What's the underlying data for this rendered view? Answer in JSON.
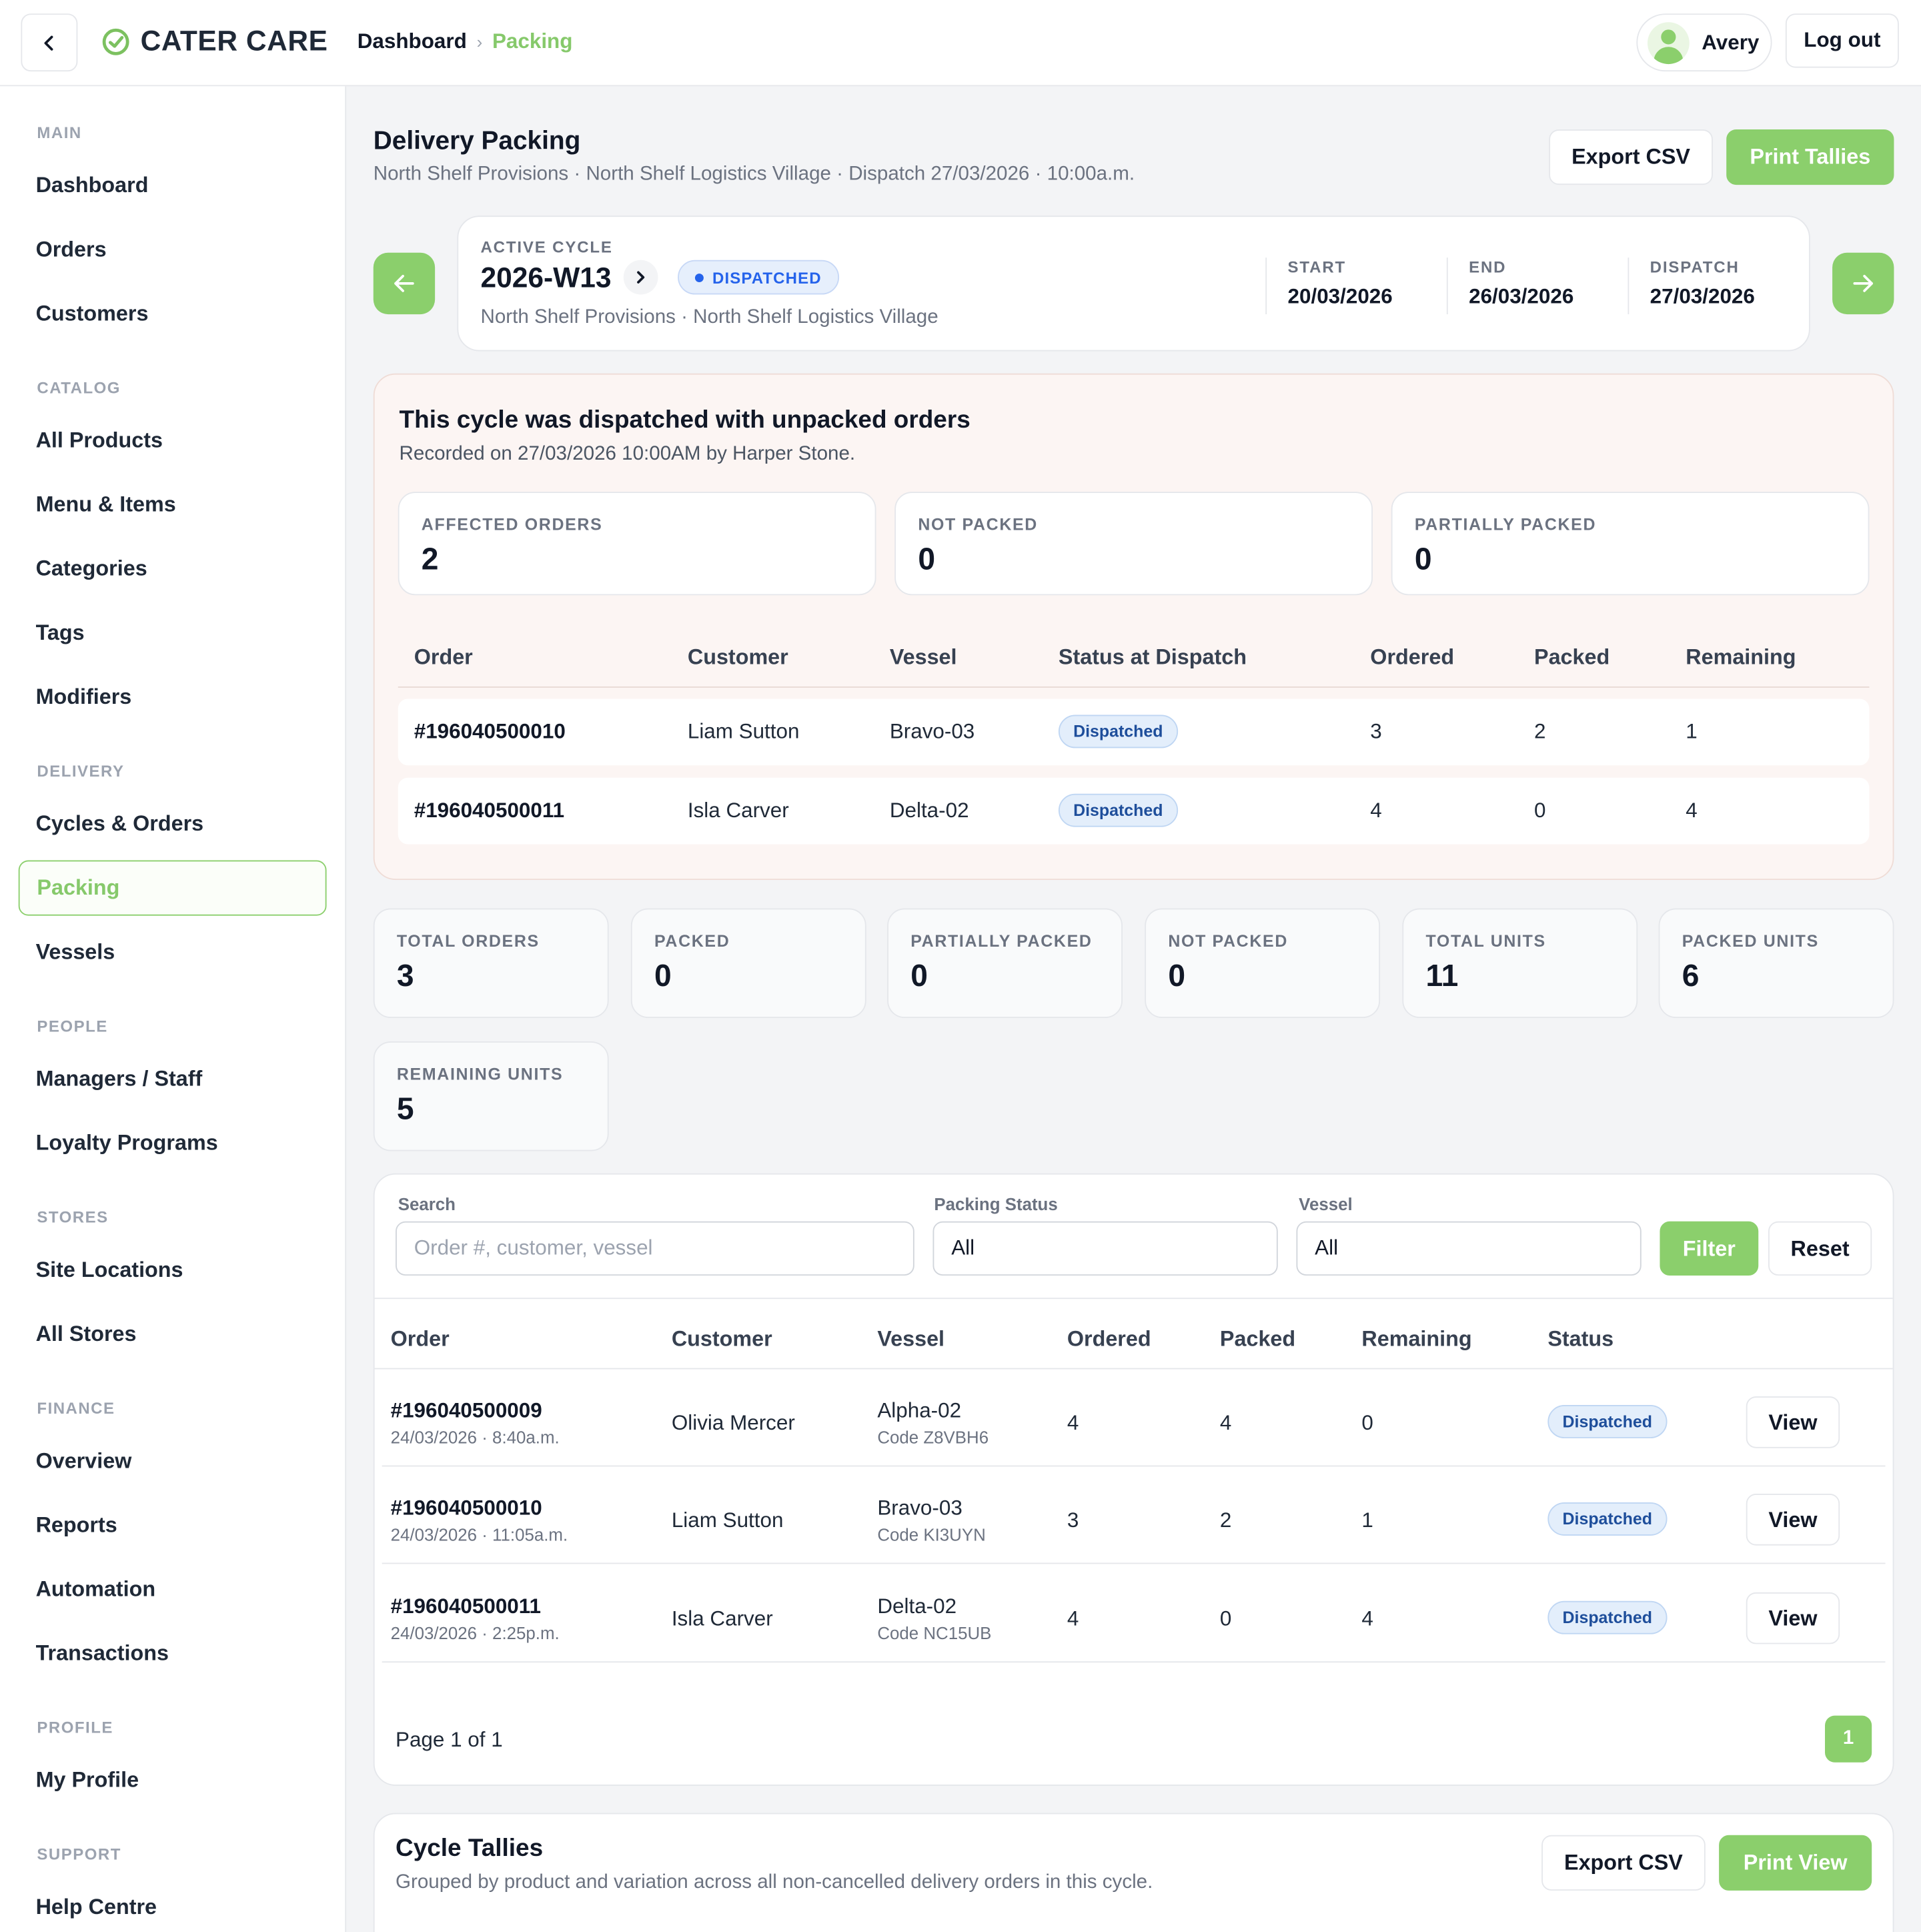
{
  "header": {
    "brand": "CATER CARE",
    "breadcrumb_home": "Dashboard",
    "breadcrumb_sep": "›",
    "breadcrumb_current": "Packing",
    "user_name": "Avery",
    "logout_label": "Log out"
  },
  "sidebar": {
    "sections": [
      {
        "title": "MAIN",
        "items": [
          "Dashboard",
          "Orders",
          "Customers"
        ]
      },
      {
        "title": "CATALOG",
        "items": [
          "All Products",
          "Menu & Items",
          "Categories",
          "Tags",
          "Modifiers"
        ]
      },
      {
        "title": "DELIVERY",
        "items": [
          "Cycles & Orders",
          "Packing",
          "Vessels"
        ]
      },
      {
        "title": "PEOPLE",
        "items": [
          "Managers / Staff",
          "Loyalty Programs"
        ]
      },
      {
        "title": "STORES",
        "items": [
          "Site Locations",
          "All Stores"
        ]
      },
      {
        "title": "FINANCE",
        "items": [
          "Overview",
          "Reports",
          "Automation",
          "Transactions"
        ]
      },
      {
        "title": "PROFILE",
        "items": [
          "My Profile"
        ]
      },
      {
        "title": "SUPPORT",
        "items": [
          "Help Centre"
        ]
      }
    ],
    "active_item": "Packing"
  },
  "page": {
    "title": "Delivery Packing",
    "subtitle": "North Shelf Provisions · North Shelf Logistics Village · Dispatch 27/03/2026 · 10:00a.m.",
    "export_label": "Export CSV",
    "print_label": "Print Tallies"
  },
  "cycle": {
    "label": "ACTIVE CYCLE",
    "code": "2026-W13",
    "status": "DISPATCHED",
    "location": "North Shelf Provisions · North Shelf Logistics Village",
    "start_label": "START",
    "start": "20/03/2026",
    "end_label": "END",
    "end": "26/03/2026",
    "dispatch_label": "DISPATCH",
    "dispatch": "27/03/2026"
  },
  "alert": {
    "title": "This cycle was dispatched with unpacked orders",
    "subtitle": "Recorded on 27/03/2026 10:00AM by Harper Stone.",
    "stats": [
      {
        "label": "AFFECTED ORDERS",
        "value": "2"
      },
      {
        "label": "NOT PACKED",
        "value": "0"
      },
      {
        "label": "PARTIALLY PACKED",
        "value": "0"
      }
    ],
    "columns": [
      "Order",
      "Customer",
      "Vessel",
      "Status at Dispatch",
      "Ordered",
      "Packed",
      "Remaining"
    ],
    "rows": [
      {
        "order": "#196040500010",
        "customer": "Liam Sutton",
        "vessel": "Bravo-03",
        "status": "Dispatched",
        "ordered": "3",
        "packed": "2",
        "remaining": "1"
      },
      {
        "order": "#196040500011",
        "customer": "Isla Carver",
        "vessel": "Delta-02",
        "status": "Dispatched",
        "ordered": "4",
        "packed": "0",
        "remaining": "4"
      }
    ]
  },
  "summary": [
    {
      "label": "TOTAL ORDERS",
      "value": "3"
    },
    {
      "label": "PACKED",
      "value": "0"
    },
    {
      "label": "PARTIALLY PACKED",
      "value": "0"
    },
    {
      "label": "NOT PACKED",
      "value": "0"
    },
    {
      "label": "TOTAL UNITS",
      "value": "11"
    },
    {
      "label": "PACKED UNITS",
      "value": "6"
    },
    {
      "label": "REMAINING UNITS",
      "value": "5"
    }
  ],
  "filters": {
    "search_label": "Search",
    "search_placeholder": "Order #, customer, vessel",
    "status_label": "Packing Status",
    "status_value": "All",
    "vessel_label": "Vessel",
    "vessel_value": "All",
    "filter_button": "Filter",
    "reset_button": "Reset"
  },
  "orders": {
    "columns": [
      "Order",
      "Customer",
      "Vessel",
      "Ordered",
      "Packed",
      "Remaining",
      "Status"
    ],
    "rows": [
      {
        "order": "#196040500009",
        "date": "24/03/2026 · 8:40a.m.",
        "customer": "Olivia Mercer",
        "vessel": "Alpha-02",
        "code": "Code Z8VBH6",
        "ordered": "4",
        "packed": "4",
        "remaining": "0",
        "status": "Dispatched",
        "action": "View"
      },
      {
        "order": "#196040500010",
        "date": "24/03/2026 · 11:05a.m.",
        "customer": "Liam Sutton",
        "vessel": "Bravo-03",
        "code": "Code KI3UYN",
        "ordered": "3",
        "packed": "2",
        "remaining": "1",
        "status": "Dispatched",
        "action": "View"
      },
      {
        "order": "#196040500011",
        "date": "24/03/2026 · 2:25p.m.",
        "customer": "Isla Carver",
        "vessel": "Delta-02",
        "code": "Code NC15UB",
        "ordered": "4",
        "packed": "0",
        "remaining": "4",
        "status": "Dispatched",
        "action": "View"
      }
    ],
    "page_info": "Page 1 of 1",
    "current_page": "1"
  },
  "tallies": {
    "title": "Cycle Tallies",
    "subtitle": "Grouped by product and variation across all non-cancelled delivery orders in this cycle.",
    "export_label": "Export CSV",
    "print_label": "Print View"
  },
  "colors": {
    "accent": "#8bcf6c",
    "status_blue": "#2563eb",
    "alert_bg": "#fcf5f3"
  }
}
